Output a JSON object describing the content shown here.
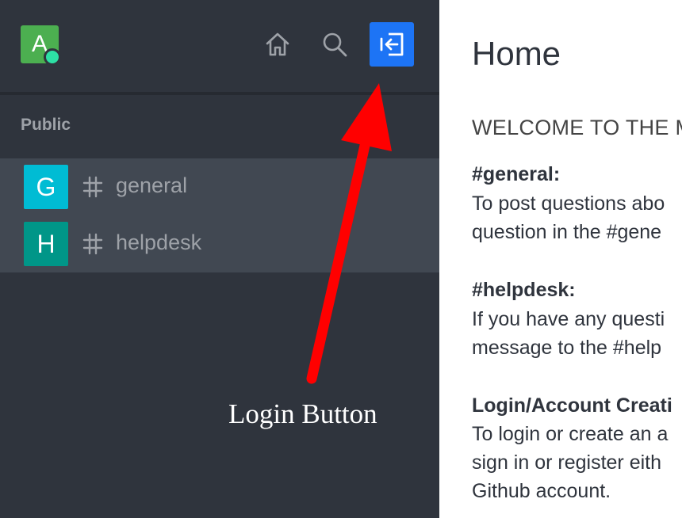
{
  "user": {
    "avatar_letter": "A",
    "status": "online"
  },
  "header": {
    "icons": [
      "home-icon",
      "search-icon",
      "login-icon"
    ],
    "accent": "#1d74f5"
  },
  "sidebar": {
    "section_title": "Public",
    "channels": [
      {
        "avatar_letter": "G",
        "avatar_color": "#00bcd4",
        "name": "general"
      },
      {
        "avatar_letter": "H",
        "avatar_color": "#009688",
        "name": "helpdesk"
      }
    ]
  },
  "annotation": {
    "label": "Login Button",
    "arrow_color": "#ff0000"
  },
  "main": {
    "title": "Home",
    "welcome": "WELCOME TO THE M",
    "blocks": [
      {
        "title": "#general:",
        "lines": [
          "To post questions abo",
          "question in the #gene"
        ]
      },
      {
        "title": "#helpdesk:",
        "lines": [
          "If you have any questi",
          "message to the #help"
        ]
      },
      {
        "title": "Login/Account Creati",
        "lines": [
          "To login or create an a",
          "sign in or register eith",
          "Github account."
        ]
      }
    ]
  }
}
